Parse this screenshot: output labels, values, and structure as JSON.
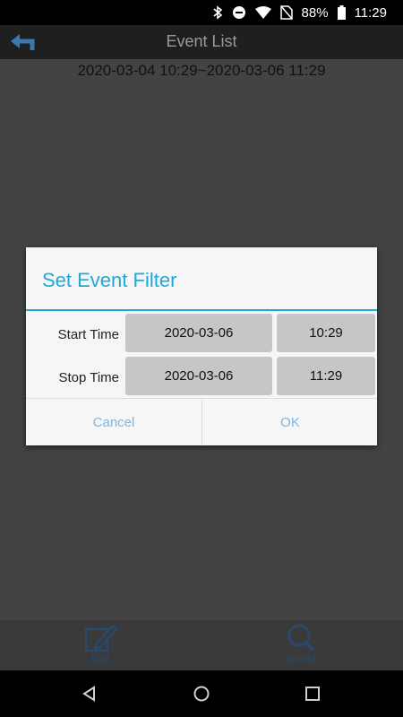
{
  "status_bar": {
    "battery_percent": "88%",
    "time": "11:29",
    "icons": [
      "bluetooth-icon",
      "do-not-disturb-icon",
      "wifi-icon",
      "no-sim-icon",
      "battery-icon"
    ]
  },
  "header": {
    "title": "Event List",
    "back_icon": "back-arrow-icon"
  },
  "content": {
    "range_text": "2020-03-04 10:29~2020-03-06 11:29"
  },
  "dialog": {
    "title": "Set Event Filter",
    "start": {
      "label": "Start Time",
      "date": "2020-03-06",
      "time": "10:29"
    },
    "stop": {
      "label": "Stop Time",
      "date": "2020-03-06",
      "time": "11:29"
    },
    "cancel_label": "Cancel",
    "ok_label": "OK",
    "accent_color": "#1eaad6"
  },
  "toolbar": {
    "edit_label": "Edit",
    "search_label": "Search"
  },
  "nav": {
    "icons": [
      "nav-back-icon",
      "nav-home-icon",
      "nav-recents-icon"
    ]
  }
}
